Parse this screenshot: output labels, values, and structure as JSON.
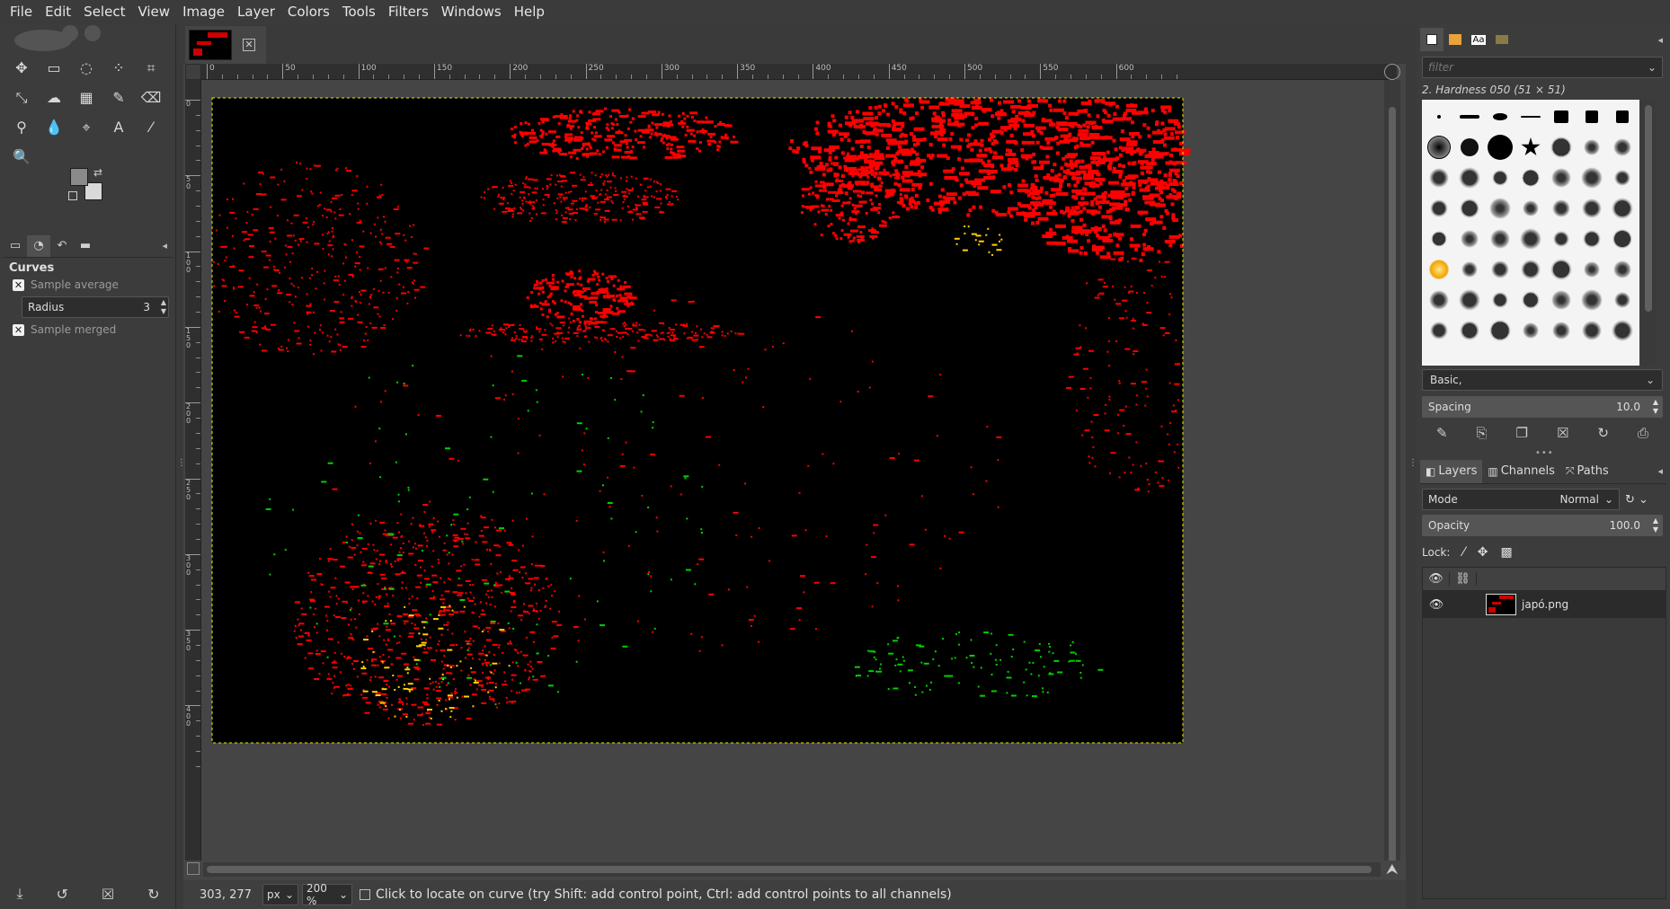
{
  "menubar": {
    "items": [
      "File",
      "Edit",
      "Select",
      "View",
      "Image",
      "Layer",
      "Colors",
      "Tools",
      "Filters",
      "Windows",
      "Help"
    ]
  },
  "toolbox": {
    "tools": [
      {
        "name": "move-tool-icon",
        "glyph": "✥"
      },
      {
        "name": "rect-select-tool-icon",
        "glyph": "▭"
      },
      {
        "name": "free-select-tool-icon",
        "glyph": "◌"
      },
      {
        "name": "fuzzy-select-tool-icon",
        "glyph": "⁘"
      },
      {
        "name": "crop-tool-icon",
        "glyph": "⌗"
      },
      {
        "name": "unified-transform-tool-icon",
        "glyph": "⤡"
      },
      {
        "name": "warp-transform-tool-icon",
        "glyph": "☁"
      },
      {
        "name": "bucket-fill-tool-icon",
        "glyph": "▦"
      },
      {
        "name": "paintbrush-tool-icon",
        "glyph": "✎"
      },
      {
        "name": "eraser-tool-icon",
        "glyph": "⌫"
      },
      {
        "name": "clone-tool-icon",
        "glyph": "⚲"
      },
      {
        "name": "smudge-tool-icon",
        "glyph": "💧"
      },
      {
        "name": "paths-tool-icon",
        "glyph": "⌖"
      },
      {
        "name": "text-tool-icon",
        "glyph": "A"
      },
      {
        "name": "color-picker-tool-icon",
        "glyph": "⁄"
      },
      {
        "name": "zoom-tool-icon",
        "glyph": "🔍"
      }
    ],
    "options_title": "Curves",
    "sample_average_label": "Sample average",
    "radius_label": "Radius",
    "radius_value": "3",
    "sample_merged_label": "Sample merged"
  },
  "image_window": {
    "ruler_labels": [
      "0",
      "50",
      "100",
      "150",
      "200",
      "250",
      "300",
      "350",
      "400",
      "450",
      "500",
      "550",
      "600"
    ],
    "vruler_labels": [
      "0",
      "50",
      "100",
      "150",
      "200",
      "250",
      "300",
      "350",
      "400"
    ],
    "layer_name": "japó.png"
  },
  "statusbar": {
    "coords": "303, 277",
    "unit": "px",
    "zoom": "200 %",
    "message": "Click to locate on curve (try Shift: add control point, Ctrl: add control points to all channels)"
  },
  "brushes": {
    "filter_placeholder": "filter",
    "current_brush": "2. Hardness 050 (51 × 51)",
    "brush_set": "Basic,",
    "spacing_label": "Spacing",
    "spacing_value": "10.0"
  },
  "layers": {
    "tabs": [
      "Layers",
      "Channels",
      "Paths"
    ],
    "mode_label": "Mode",
    "mode_value": "Normal",
    "opacity_label": "Opacity",
    "opacity_value": "100.0",
    "lock_label": "Lock:"
  },
  "colors": {
    "accent_red": "#ff0000",
    "canvas_bg": "#000000",
    "selection_border": "#e8e800"
  }
}
